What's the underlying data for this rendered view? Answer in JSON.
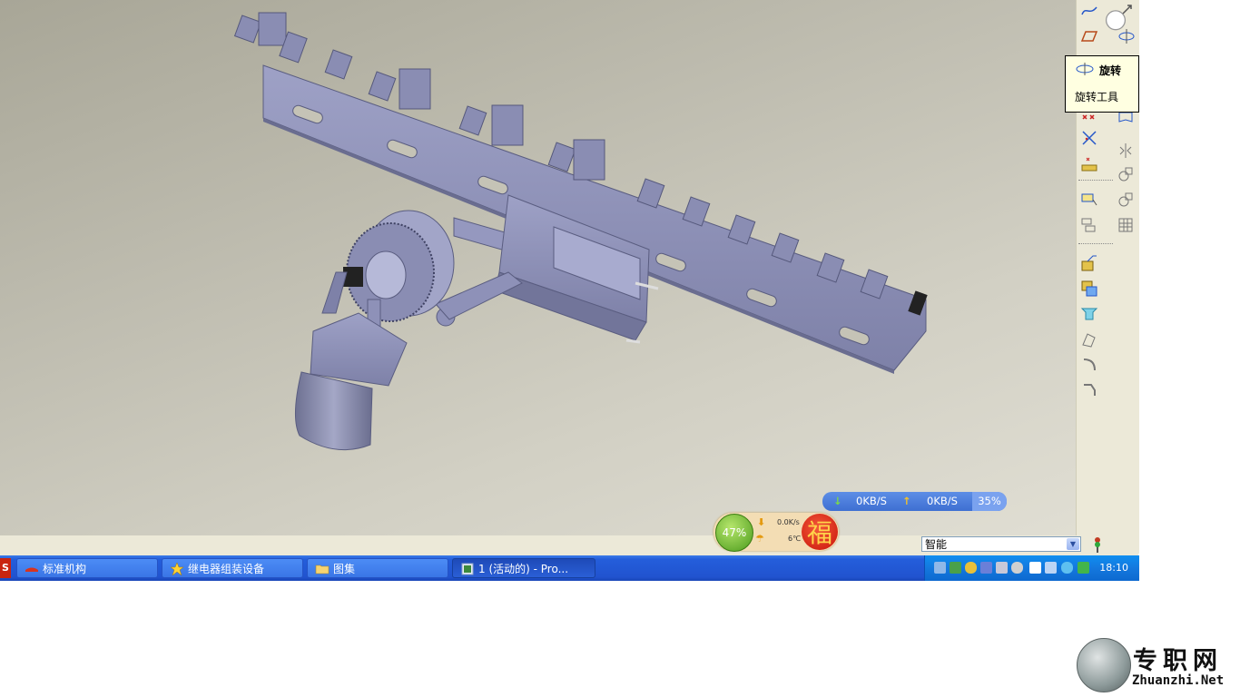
{
  "tooltip": {
    "title": "旋转",
    "description": "旋转工具"
  },
  "right_toolbar": {
    "buttons": [
      "sketch-icon",
      "plane-icon",
      "rotate-icon",
      "point-icon",
      "axis-cross-icon",
      "coord-icon",
      "select-box-icon",
      "layers-icon",
      "extrude-icon",
      "copy-feature-icon",
      "hole-icon",
      "revolve-icon",
      "round-icon",
      "chamfer-icon",
      "mirror-icon",
      "pattern-icon",
      "shell-icon",
      "grid-icon"
    ]
  },
  "status": {
    "filter_select_value": "智能"
  },
  "net_widget": {
    "download": "0KB/S",
    "upload": "0KB/S",
    "percent": "35%"
  },
  "ball_widget": {
    "percent": "47%",
    "speed": "0.0K/s",
    "temperature": "6℃",
    "fu_char": "福"
  },
  "taskbar": {
    "start_stub": "S",
    "buttons": [
      {
        "label": "标准机构",
        "icon": "folder-red-icon"
      },
      {
        "label": "继电器组装设备",
        "icon": "star-icon"
      },
      {
        "label": "图集",
        "icon": "folder-icon"
      },
      {
        "label": "1 (活动的) - Pro...",
        "icon": "proe-window-icon"
      }
    ],
    "clock": "18:10"
  },
  "watermark": {
    "cn": "专职网",
    "en": "Zhuanzhi.Net"
  },
  "colors": {
    "model_body": "#8e91b8",
    "model_shade": "#6e7198",
    "taskbar": "#245edb",
    "tooltip_bg": "#ffffe1"
  }
}
